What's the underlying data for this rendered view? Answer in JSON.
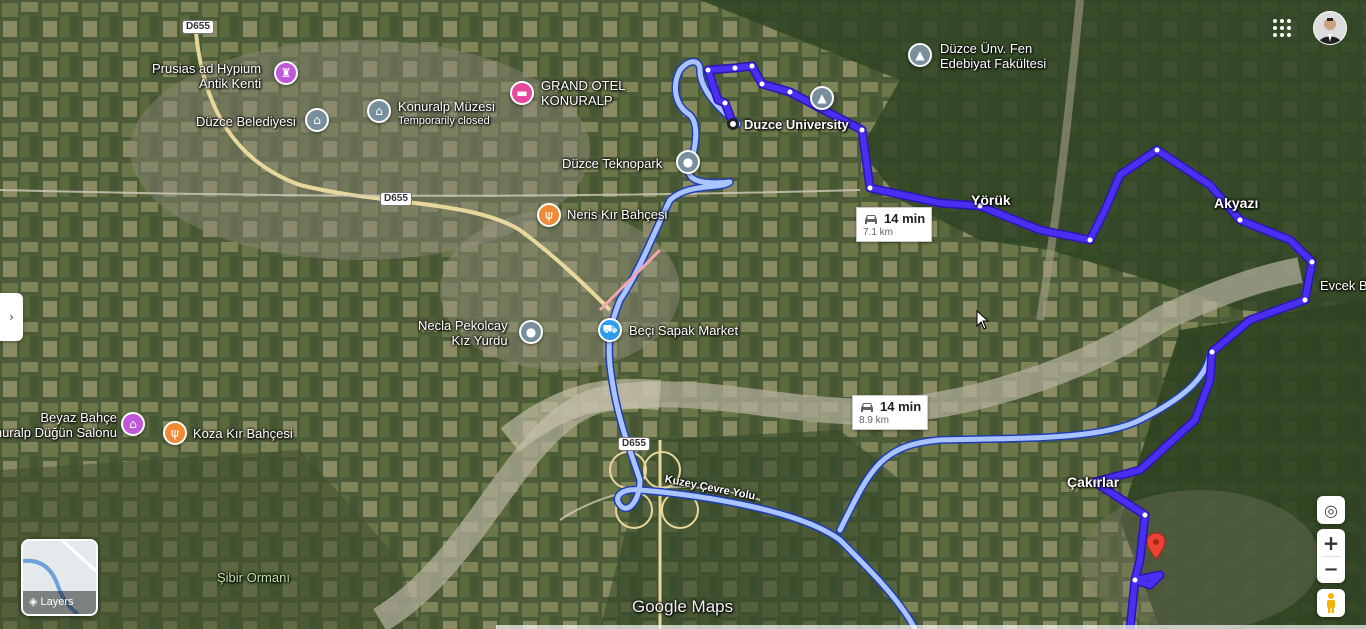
{
  "places": [
    {
      "name": "Prusias ad Hypium\nAntik Kenti",
      "icon": "monument-icon",
      "color": "#c158dc"
    },
    {
      "name": "Düzce Belediyesi",
      "icon": "government-icon",
      "color": "#78909c"
    },
    {
      "name": "Konuralp Müzesi",
      "sub": "Temporarily closed",
      "icon": "museum-icon",
      "color": "#78909c"
    },
    {
      "name": "GRAND OTEL\nKONURALP",
      "icon": "hotel-icon",
      "color": "#e7489c"
    },
    {
      "name": "Düzce Ünv. Fen\nEdebiyat Fakültesi",
      "icon": "school-icon",
      "color": "#78909c"
    },
    {
      "name": "Duzce University",
      "icon": "origin-dot-icon",
      "color": "#ffffff"
    },
    {
      "name": "Düzce Teknopark",
      "icon": "location-icon",
      "color": "#78909c"
    },
    {
      "name": "Neris Kır Bahçesi",
      "icon": "restaurant-icon",
      "color": "#f08a37"
    },
    {
      "name": "Necla Pekolcay\nKız Yurdu",
      "icon": "location-icon",
      "color": "#78909c"
    },
    {
      "name": "Beçi Sapak Market",
      "icon": "shopping-cart-icon",
      "color": "#2c9ded"
    },
    {
      "name": "Beyaz Bahçe\nKonuralp Düğün Salonu",
      "icon": "wedding-hall-icon",
      "color": "#c158dc"
    },
    {
      "name": "Koza Kır Bahçesi",
      "icon": "restaurant-icon",
      "color": "#f08a37"
    }
  ],
  "areas": [
    "Yörük",
    "Akyazı",
    "Evcek B",
    "Çakırlar",
    "Şibir Ormanı"
  ],
  "roads": [
    "D655",
    "D655",
    "D655",
    "Kuzey Çevre Yolu"
  ],
  "routes": [
    {
      "time": "14 min",
      "distance": "7.1 km",
      "selected": true,
      "color": "#4a2ff0"
    },
    {
      "time": "14 min",
      "distance": "8.9 km",
      "selected": false,
      "color": "#a9c4ff"
    }
  ],
  "controls": {
    "layers_label": "Layers",
    "zoom_in": "+",
    "zoom_out": "−",
    "brand": "Google Maps"
  }
}
